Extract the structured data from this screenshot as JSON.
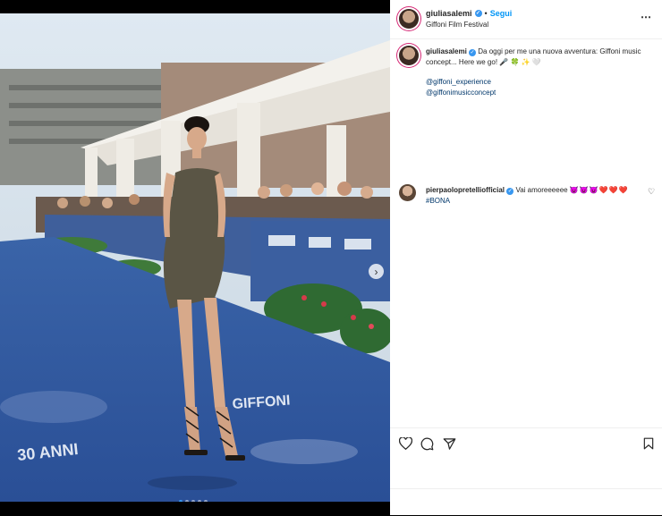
{
  "post": {
    "username": "giuliasalemi",
    "follow_separator": "•",
    "follow_label": "Segui",
    "location": "Giffoni Film Festival",
    "more_icon": "⋯"
  },
  "caption": {
    "username": "giuliasalemi",
    "text": "Da oggi per me una nuova avventura: Giffoni music concept... Here we go! 🎤 🍀 ✨ 🤍",
    "mentions": [
      "@giffoni_experience",
      "@giffonimusicconcept"
    ]
  },
  "comments": [
    {
      "username": "pierpaolopretelliofficial",
      "text": "Vai amoreeeeee",
      "emojis": "😈😈😈❤️❤️❤️",
      "hashtag": "#BONA"
    }
  ],
  "photo": {
    "next_icon": "›",
    "banner_text": "GIFFONI",
    "carpet_text": "30 ANNI",
    "dots": [
      true,
      false,
      false,
      false,
      false
    ]
  },
  "colors": {
    "accent": "#0095f6",
    "verified": "#3897f0",
    "carpet": "#2f5fb0"
  }
}
